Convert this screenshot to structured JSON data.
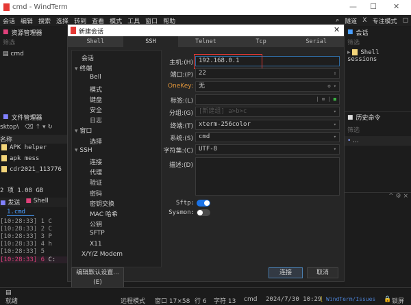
{
  "window": {
    "title": "cmd - WindTerm",
    "minimize": "—",
    "maximize": "☐",
    "close": "✕"
  },
  "menu": [
    "会话",
    "编辑",
    "搜索",
    "选择",
    "转到",
    "查看",
    "模式",
    "工具",
    "窗口",
    "帮助"
  ],
  "menu_right": {
    "tunnel": "隧道",
    "x": "X",
    "focus": "专注模式"
  },
  "explorer": {
    "title": "资源管理器",
    "filter": "筛选",
    "items": [
      "cmd"
    ]
  },
  "filemanager": {
    "title": "文件管理器",
    "path": "sktop\\",
    "column": "名称",
    "files": [
      "APK helper",
      "apk mess",
      "cdr2021_113776"
    ],
    "summary": "2 项 1.08 GB"
  },
  "bottom_tabs": [
    "发送",
    "Shell"
  ],
  "term": {
    "tab": "1.cmd",
    "lines": [
      {
        "time": "[10:28:33]",
        "num": "1",
        "text": "C"
      },
      {
        "time": "[10:28:33]",
        "num": "2",
        "text": "C"
      },
      {
        "time": "[10:28:33]",
        "num": "3",
        "text": "P"
      },
      {
        "time": "[10:28:33]",
        "num": "4",
        "text": "h"
      },
      {
        "time": "[10:28:33]",
        "num": "5",
        "text": ""
      },
      {
        "time": "[10:28:33]",
        "num": "6",
        "text": "C:"
      }
    ]
  },
  "sessions": {
    "title": "会话",
    "filter": "筛选",
    "items": [
      "Shell sessions"
    ]
  },
  "history": {
    "title": "历史命令",
    "filter": "筛选",
    "items": [
      "..."
    ]
  },
  "dialog": {
    "title": "新建会话",
    "tabs": [
      "Shell",
      "SSH",
      "Telnet",
      "Tcp",
      "Serial"
    ],
    "active_tab": "SSH",
    "tree": [
      {
        "label": "会话",
        "level": 0
      },
      {
        "label": "终端",
        "level": 0,
        "expand": "▾"
      },
      {
        "label": "Bell",
        "level": 2
      },
      {
        "label": "模式",
        "level": 2
      },
      {
        "label": "键盘",
        "level": 2
      },
      {
        "label": "安全",
        "level": 2
      },
      {
        "label": "日志",
        "level": 2
      },
      {
        "label": "窗口",
        "level": 0,
        "expand": "▾"
      },
      {
        "label": "选择",
        "level": 2
      },
      {
        "label": "SSH",
        "level": 0,
        "expand": "▾"
      },
      {
        "label": "连接",
        "level": 2
      },
      {
        "label": "代理",
        "level": 2
      },
      {
        "label": "验证",
        "level": 2
      },
      {
        "label": "密码",
        "level": 2
      },
      {
        "label": "密钥交换",
        "level": 2
      },
      {
        "label": "MAC 哈希",
        "level": 2
      },
      {
        "label": "公钥",
        "level": 2
      },
      {
        "label": "SFTP",
        "level": 2
      },
      {
        "label": "X11",
        "level": 2
      },
      {
        "label": "X/Y/Z Modem",
        "level": 0
      }
    ],
    "fields": {
      "host": {
        "label": "主机:(H)",
        "value": "192.168.0.1"
      },
      "port": {
        "label": "端口:(P)",
        "value": "22"
      },
      "onekey": {
        "label": "OneKey:",
        "value": "无"
      },
      "tag": {
        "label": "标签:(L)",
        "value": ""
      },
      "group": {
        "label": "分组:(G)",
        "placeholder": "[新建组] a>b>c"
      },
      "terminal": {
        "label": "终端:(T)",
        "value": "xterm-256color"
      },
      "system": {
        "label": "系统:(S)",
        "value": "cmd"
      },
      "charset": {
        "label": "字符集:(C)",
        "value": "UTF-8"
      },
      "desc": {
        "label": "描述:(D)",
        "value": ""
      }
    },
    "sftp": {
      "label": "Sftp:",
      "on": true
    },
    "sysmon": {
      "label": "Sysmon:",
      "on": false
    },
    "edit_defaults": "编辑默认设置...(E)",
    "connect": "连接",
    "cancel": "取消"
  },
  "statusbar": {
    "ready": "就绪",
    "mode": "远程模式",
    "window": "窗口 17×58",
    "row": "行 6",
    "col": "字符 13",
    "shell": "cmd",
    "datetime": "2024/7/30 10:29",
    "link": "WindTerm/Issues",
    "lock": "锁屏"
  },
  "colors": {
    "accent": "#1a73e8",
    "highlight": "#e53935",
    "onekey": "#e0953a",
    "magenta": "#e0407a"
  }
}
